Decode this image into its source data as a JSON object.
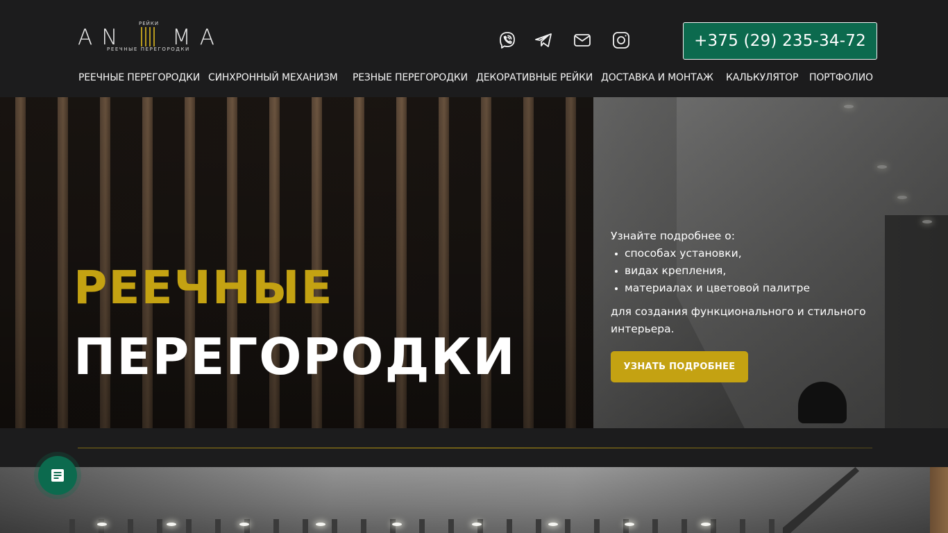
{
  "logo": {
    "left": "AN",
    "right": "MA",
    "top": "РЕЙКИ",
    "sub": "РЕЕЧНЫЕ ПЕРЕГОРОДКИ"
  },
  "social": [
    {
      "name": "viber-icon"
    },
    {
      "name": "telegram-icon"
    },
    {
      "name": "mail-icon"
    },
    {
      "name": "instagram-icon"
    }
  ],
  "phone": "+375 (29) 235-34-72",
  "nav": [
    {
      "label": "РЕЕЧНЫЕ ПЕРЕГОРОДКИ"
    },
    {
      "label": "СИНХРОННЫЙ МЕХАНИЗМ"
    },
    {
      "label": "РЕЗНЫЕ ПЕРЕГОРОДКИ"
    },
    {
      "label": "ДЕКОРАТИВНЫЕ РЕЙКИ"
    },
    {
      "label": "ДОСТАВКА И МОНТАЖ"
    },
    {
      "label": "КАЛЬКУЛЯТОР"
    },
    {
      "label": "ПОРТФОЛИО"
    }
  ],
  "hero": {
    "title_line1": "РЕЕЧНЫЕ",
    "title_line2": "ПЕРЕГОРОДКИ",
    "intro": "Узнайте подробнее о:",
    "bullets": [
      "способах установки,",
      "видах крепления,",
      "материалах и цветовой палитре"
    ],
    "after": "для создания функционального и стильного интерьера.",
    "cta": "УЗНАТЬ ПОДРОБНЕЕ"
  },
  "fab": {
    "icon": "document-icon"
  },
  "colors": {
    "background": "#1c1c1d",
    "accent_green": "#0c6a4e",
    "accent_gold": "#c4a212",
    "text": "#ffffff"
  }
}
